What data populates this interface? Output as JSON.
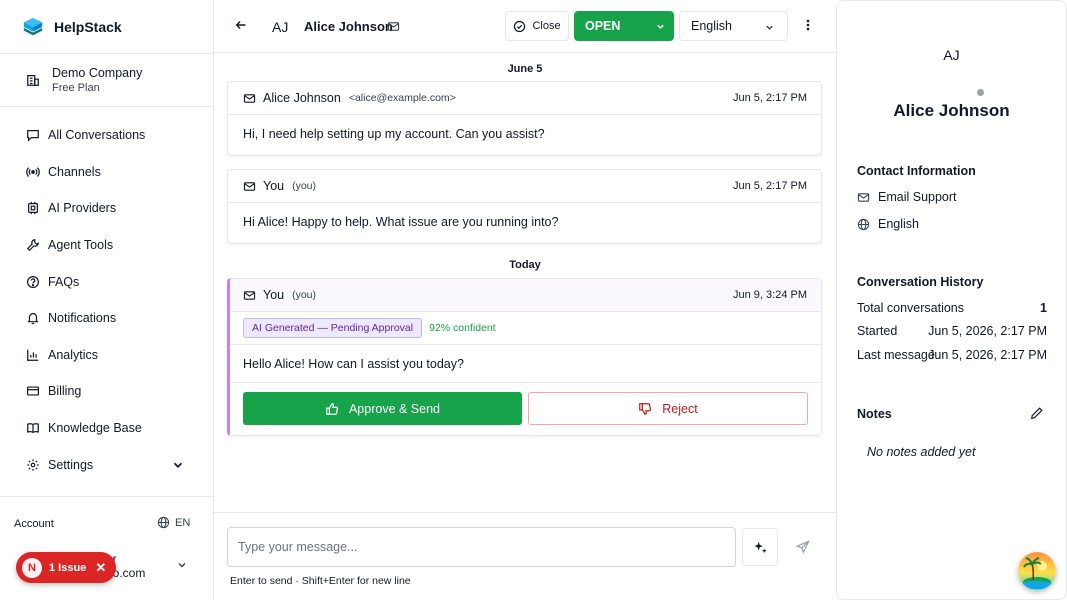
{
  "brand": {
    "name": "HelpStack"
  },
  "org": {
    "name": "Demo Company",
    "plan": "Free Plan"
  },
  "sidebar": {
    "items": [
      {
        "label": "All Conversations",
        "icon": "chat-icon"
      },
      {
        "label": "Channels",
        "icon": "broadcast-icon"
      },
      {
        "label": "AI Providers",
        "icon": "ai-icon"
      },
      {
        "label": "Agent Tools",
        "icon": "wrench-icon"
      },
      {
        "label": "FAQs",
        "icon": "question-icon"
      },
      {
        "label": "Notifications",
        "icon": "bell-icon"
      },
      {
        "label": "Analytics",
        "icon": "chart-icon"
      },
      {
        "label": "Billing",
        "icon": "card-icon"
      },
      {
        "label": "Knowledge Base",
        "icon": "book-icon"
      },
      {
        "label": "Settings",
        "icon": "gear-icon"
      }
    ]
  },
  "account": {
    "label": "Account",
    "lang": "EN",
    "user_line1": "er",
    "user_line2": "no.com"
  },
  "issue_badge": {
    "initial": "N",
    "text": "1 Issue"
  },
  "topbar": {
    "avatar": "AJ",
    "contact_name": "Alice Johnson",
    "close_label": "Close",
    "status": "OPEN",
    "language": "English"
  },
  "thread": {
    "date_1": "June 5",
    "date_2": "Today",
    "messages": [
      {
        "sender": "Alice Johnson",
        "sender_sub": "<alice@example.com>",
        "time": "Jun 5, 2:17 PM",
        "body": "Hi, I need help setting up my account. Can you assist?"
      },
      {
        "sender": "You",
        "sender_sub": "(you)",
        "time": "Jun 5, 2:17 PM",
        "body": "Hi Alice! Happy to help. What issue are you running into?"
      }
    ],
    "ai_message": {
      "sender": "You",
      "sender_sub": "(you)",
      "time": "Jun 9, 3:24 PM",
      "badge": "AI Generated — Pending Approval",
      "confidence": "92% confident",
      "body": "Hello Alice! How can I assist you today?",
      "approve_label": "Approve & Send",
      "reject_label": "Reject"
    }
  },
  "composer": {
    "placeholder": "Type your message...",
    "hint": "Enter to send · Shift+Enter for new line"
  },
  "contact_panel": {
    "avatar": "AJ",
    "name": "Alice Johnson",
    "contact_info_title": "Contact Information",
    "channel": "Email Support",
    "language": "English",
    "history_title": "Conversation History",
    "history": [
      {
        "label": "Total conversations",
        "value": "1"
      },
      {
        "label": "Started",
        "value": "Jun 5, 2026, 2:17 PM"
      },
      {
        "label": "Last message",
        "value": "Jun 5, 2026, 2:17 PM"
      }
    ],
    "notes_title": "Notes",
    "notes_empty": "No notes added yet"
  },
  "colors": {
    "primary_green": "#16a34a",
    "danger_red": "#dc2626",
    "ai_purple": "#c084fc"
  }
}
